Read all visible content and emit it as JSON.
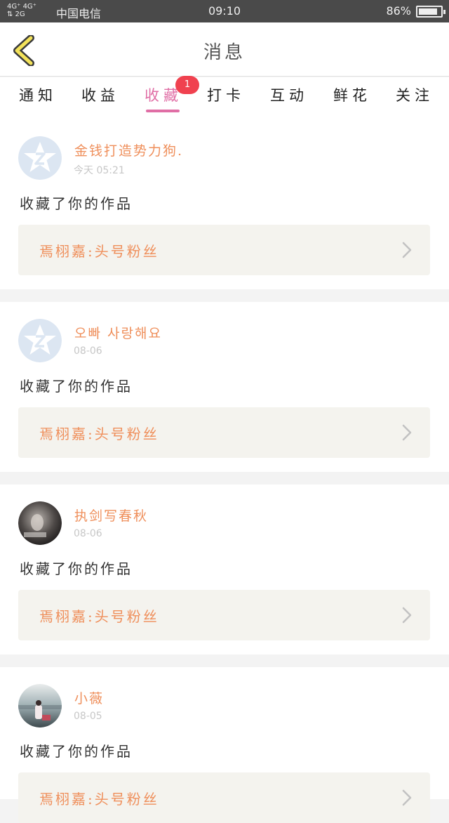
{
  "status_bar": {
    "signal_top": "4G⁺ 4G⁺",
    "signal_bottom": "⇅ 2G",
    "carrier": "中国电信",
    "time": "09:10",
    "battery_percent": "86%",
    "battery_level": 0.86
  },
  "header": {
    "title": "消息",
    "back_icon": "chevron-left-icon"
  },
  "tabs": {
    "items": [
      {
        "label": "通知"
      },
      {
        "label": "收益"
      },
      {
        "label": "收藏",
        "badge": "1"
      },
      {
        "label": "打卡"
      },
      {
        "label": "互动"
      },
      {
        "label": "鲜花"
      },
      {
        "label": "关注"
      }
    ],
    "active_index": 2
  },
  "colors": {
    "accent_pink": "#e06ea5",
    "username_orange": "#ef8f5b",
    "badge_red": "#f0414f",
    "status_bar_bg": "#4a4a4a"
  },
  "messages": [
    {
      "username": "金钱打造势力狗.",
      "time": "今天 05:21",
      "action": "收藏了你的作品",
      "work_title": "焉栩嘉:头号粉丝",
      "avatar": "default-qq-avatar"
    },
    {
      "username": "오빠 사랑해요",
      "time": "08-06",
      "action": "收藏了你的作品",
      "work_title": "焉栩嘉:头号粉丝",
      "avatar": "default-qq-avatar"
    },
    {
      "username": "执剑写春秋",
      "time": "08-06",
      "action": "收藏了你的作品",
      "work_title": "焉栩嘉:头号粉丝",
      "avatar": "photo-avatar-dark"
    },
    {
      "username": "小薇",
      "time": "08-05",
      "action": "收藏了你的作品",
      "work_title": "焉栩嘉:头号粉丝",
      "avatar": "photo-avatar-lake"
    }
  ]
}
